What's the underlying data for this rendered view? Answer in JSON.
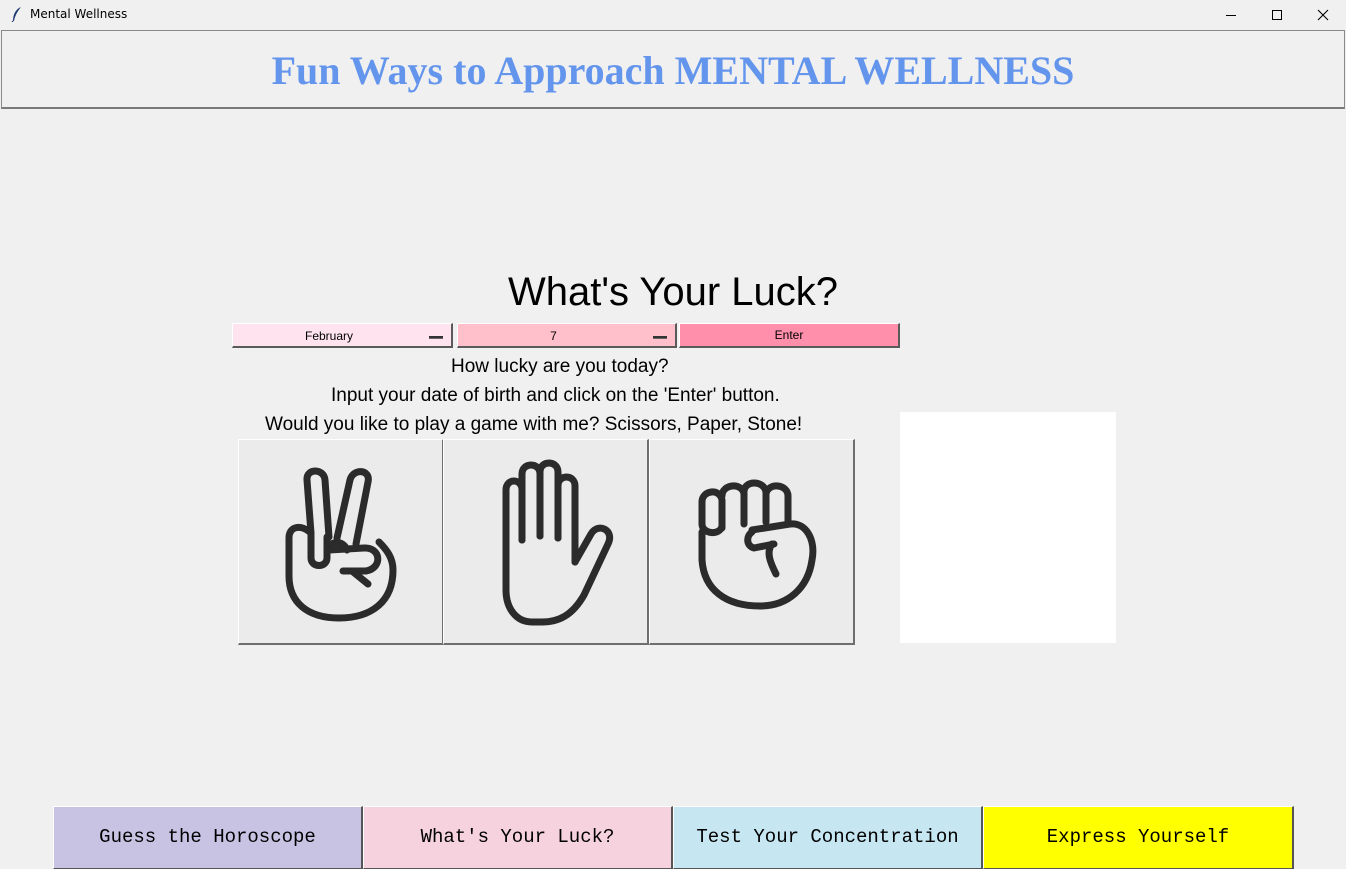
{
  "window": {
    "title": "Mental Wellness",
    "app_icon": "feather-icon",
    "controls": [
      "minimize-icon",
      "maximize-icon",
      "close-icon"
    ]
  },
  "header": {
    "title": "Fun Ways to Approach MENTAL WELLNESS",
    "title_color": "#6495ed"
  },
  "luck": {
    "title": "What's Your Luck?",
    "month_select": {
      "value": "February",
      "bg": "#ffe4f0"
    },
    "day_select": {
      "value": "7",
      "bg": "#ffc0cb"
    },
    "enter_button": {
      "label": "Enter",
      "bg": "#ff8fab"
    },
    "lines": [
      "How lucky are you today?",
      "Input your date of birth and click on the 'Enter' button.",
      "Would you like to play a game with me? Scissors, Paper, Stone!"
    ],
    "game_buttons": [
      "scissors-hand-icon",
      "paper-hand-icon",
      "stone-fist-icon"
    ]
  },
  "nav": {
    "buttons": [
      {
        "label": "Guess the Horoscope",
        "bg": "#c8c3e3"
      },
      {
        "label": "What's Your Luck?",
        "bg": "#f6d2de"
      },
      {
        "label": "Test Your Concentration",
        "bg": "#c6e6f2"
      },
      {
        "label": "Express Yourself",
        "bg": "#ffff00"
      }
    ]
  }
}
